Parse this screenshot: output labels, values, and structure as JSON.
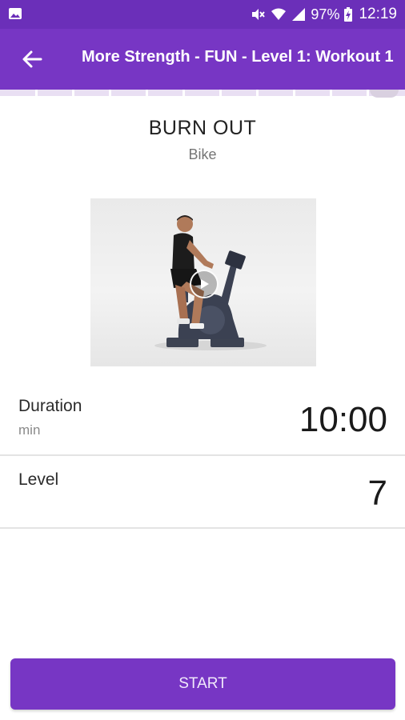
{
  "status_bar": {
    "battery_percent": "97%",
    "time": "12:19",
    "icons": [
      "image-notification-icon",
      "mute-icon",
      "wifi-icon",
      "signal-icon",
      "battery-charging-icon"
    ]
  },
  "app_bar": {
    "title": "More Strength - FUN - Level 1: Workout 1",
    "back_icon": "arrow-left-icon"
  },
  "exercise": {
    "title": "BURN OUT",
    "equipment": "Bike",
    "video_icon": "play-icon"
  },
  "details": {
    "duration": {
      "label": "Duration",
      "unit": "min",
      "value": "10:00"
    },
    "level": {
      "label": "Level",
      "value": "7"
    }
  },
  "actions": {
    "start_label": "START"
  },
  "colors": {
    "status_bar": "#6b2fb9",
    "app_bar": "#7736c4",
    "primary_button": "#7736c4"
  }
}
